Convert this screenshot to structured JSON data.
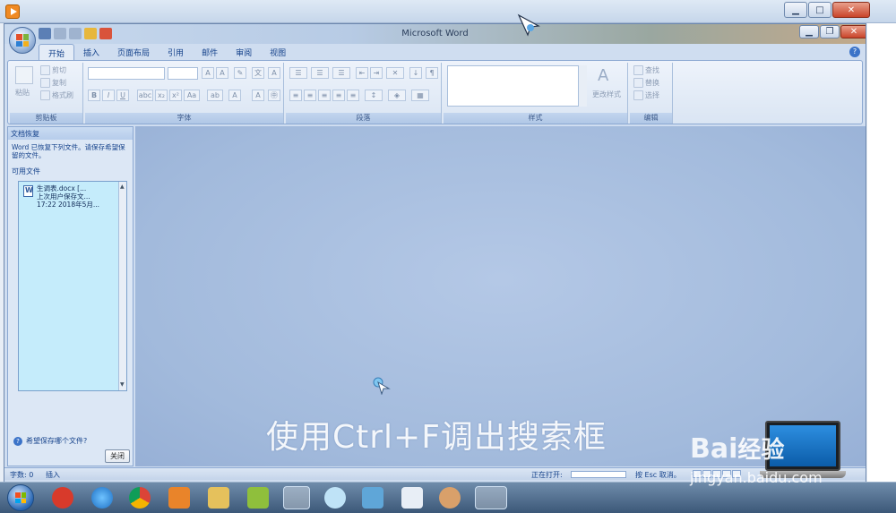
{
  "window": {
    "title": "Microsoft Word"
  },
  "tabs": [
    {
      "label": "开始",
      "active": true
    },
    {
      "label": "插入"
    },
    {
      "label": "页面布局"
    },
    {
      "label": "引用"
    },
    {
      "label": "邮件"
    },
    {
      "label": "审阅"
    },
    {
      "label": "视图"
    }
  ],
  "ribbon": {
    "clipboard": {
      "label": "剪贴板",
      "paste": "粘贴",
      "cut": "剪切",
      "copy": "复制",
      "format_painter": "格式刷"
    },
    "font": {
      "label": "字体"
    },
    "paragraph": {
      "label": "段落"
    },
    "styles": {
      "label": "样式",
      "change_styles": "更改样式"
    },
    "editing": {
      "label": "编辑",
      "find": "查找",
      "replace": "替换",
      "select": "选择"
    }
  },
  "recovery_pane": {
    "title": "文档恢复",
    "description": "Word 已恢复下列文件。请保存希望保留的文件。",
    "available_files": "可用文件",
    "file": {
      "name": "生调表.docx [...",
      "status": "上次用户保存文...",
      "time": "17:22 2018年5月..."
    },
    "which_file_link": "希望保存哪个文件?",
    "close_button": "关闭"
  },
  "caption": "使用Ctrl+F调出搜索框",
  "statusbar": {
    "word_count": "字数: 0",
    "insert_mode": "插入",
    "opening": "正在打开:",
    "esc_cancel": "按 Esc 取消。"
  },
  "watermark": {
    "brand": "Bai",
    "brand2": "经验",
    "url": "jingyan.baidu.com"
  },
  "colors": {
    "ribbon_text": "#15428b",
    "doc_bg": "#a2badc",
    "pane_list_bg": "#c5ecfb"
  }
}
